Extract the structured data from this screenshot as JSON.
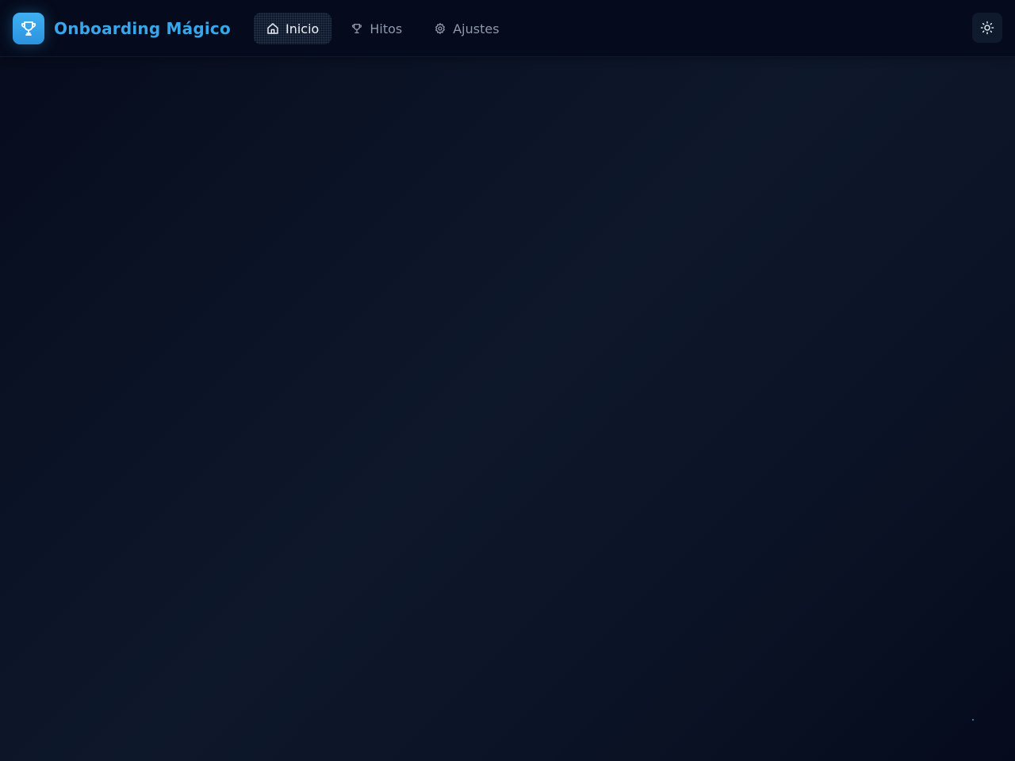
{
  "header": {
    "app_title": "Onboarding Mágico",
    "logo_icon": "trophy-icon",
    "nav": [
      {
        "label": "Inicio",
        "icon": "home-icon",
        "active": true
      },
      {
        "label": "Hitos",
        "icon": "trophy-icon",
        "active": false
      },
      {
        "label": "Ajustes",
        "icon": "gear-icon",
        "active": false
      }
    ],
    "theme_toggle_icon": "sun-icon"
  },
  "colors": {
    "accent": "#39a5ea",
    "background": "#0b1426",
    "header_background": "#050b1c"
  }
}
